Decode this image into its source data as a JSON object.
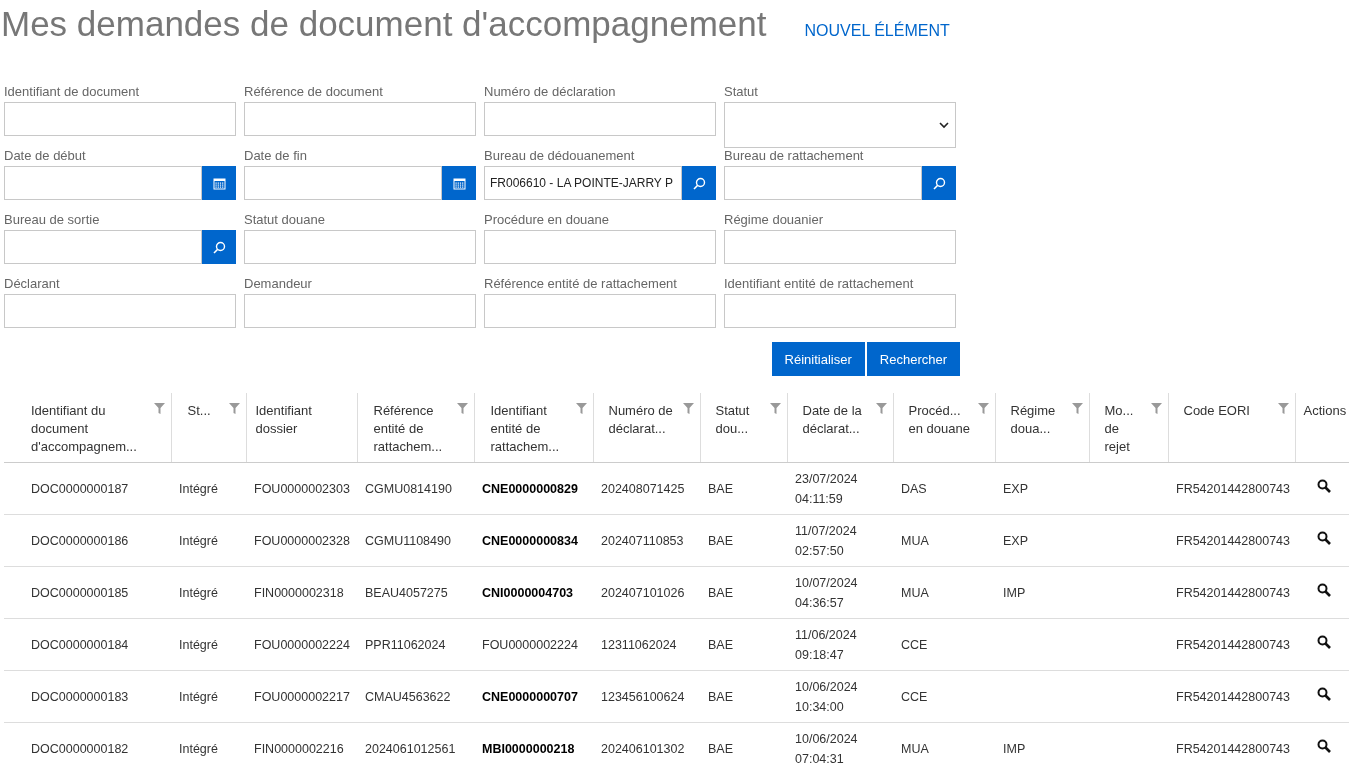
{
  "header": {
    "title": "Mes demandes de document d'accompagnement",
    "new_link": "NOUVEL ÉLÉMENT"
  },
  "filters": [
    {
      "label": "Identifiant de document",
      "kind": "text"
    },
    {
      "label": "Référence de document",
      "kind": "text"
    },
    {
      "label": "Numéro de déclaration",
      "kind": "text"
    },
    {
      "label": "Statut",
      "kind": "select"
    },
    {
      "label": "Date de début",
      "kind": "date"
    },
    {
      "label": "Date de fin",
      "kind": "date"
    },
    {
      "label": "Bureau de dédouanement",
      "kind": "lookup",
      "value": "FR006610 - LA POINTE-JARRY P"
    },
    {
      "label": "Bureau de rattachement",
      "kind": "lookup"
    },
    {
      "label": "Bureau de sortie",
      "kind": "lookup"
    },
    {
      "label": "Statut douane",
      "kind": "text"
    },
    {
      "label": "Procédure en douane",
      "kind": "text"
    },
    {
      "label": "Régime douanier",
      "kind": "text"
    },
    {
      "label": "Déclarant",
      "kind": "text"
    },
    {
      "label": "Demandeur",
      "kind": "text"
    },
    {
      "label": "Référence entité de rattachement",
      "kind": "text"
    },
    {
      "label": "Identifiant entité de rattachement",
      "kind": "text"
    }
  ],
  "buttons": [
    "Réinitialiser",
    "Rechercher"
  ],
  "table": {
    "columns": [
      {
        "label": "Identifiant du document d'accompagnem...",
        "filterable": true
      },
      {
        "label": "St...",
        "filterable": true
      },
      {
        "label": "Identifiant dossier",
        "filterable": false
      },
      {
        "label": "Référence entité de rattachem...",
        "filterable": true
      },
      {
        "label": "Identifiant entité de rattachem...",
        "filterable": true
      },
      {
        "label": "Numéro de déclarat...",
        "filterable": true
      },
      {
        "label": "Statut dou...",
        "filterable": true
      },
      {
        "label": "Date de la déclarat...",
        "filterable": true
      },
      {
        "label": "Procéd... en douane",
        "filterable": true
      },
      {
        "label": "Régime doua...",
        "filterable": true
      },
      {
        "label": "Mo... de rejet",
        "filterable": true
      },
      {
        "label": "Code EORI",
        "filterable": true
      },
      {
        "label": "Actions",
        "filterable": false
      }
    ],
    "rows": [
      {
        "entity_bold": true,
        "cells": [
          "DOC0000000187",
          "Intégré",
          "FOU0000002303",
          "CGMU0814190",
          "CNE0000000829",
          "202408071425",
          "BAE",
          "23/07/2024 04:11:59",
          "DAS",
          "EXP",
          "",
          "FR54201442800743"
        ]
      },
      {
        "entity_bold": true,
        "cells": [
          "DOC0000000186",
          "Intégré",
          "FOU0000002328",
          "CGMU1108490",
          "CNE0000000834",
          "202407110853",
          "BAE",
          "11/07/2024 02:57:50",
          "MUA",
          "EXP",
          "",
          "FR54201442800743"
        ]
      },
      {
        "entity_bold": true,
        "cells": [
          "DOC0000000185",
          "Intégré",
          "FIN0000002318",
          "BEAU4057275",
          "CNI0000004703",
          "202407101026",
          "BAE",
          "10/07/2024 04:36:57",
          "MUA",
          "IMP",
          "",
          "FR54201442800743"
        ]
      },
      {
        "entity_bold": false,
        "cells": [
          "DOC0000000184",
          "Intégré",
          "FOU0000002224",
          "PPR11062024",
          "FOU0000002224",
          "12311062024",
          "BAE",
          "11/06/2024 09:18:47",
          "CCE",
          "",
          "",
          "FR54201442800743"
        ]
      },
      {
        "entity_bold": true,
        "cells": [
          "DOC0000000183",
          "Intégré",
          "FOU0000002217",
          "CMAU4563622",
          "CNE0000000707",
          "123456100624",
          "BAE",
          "10/06/2024 10:34:00",
          "CCE",
          "",
          "",
          "FR54201442800743"
        ]
      },
      {
        "entity_bold": true,
        "cells": [
          "DOC0000000182",
          "Intégré",
          "FIN0000002216",
          "2024061012561",
          "MBI0000000218",
          "202406101302",
          "BAE",
          "10/06/2024 07:04:31",
          "MUA",
          "IMP",
          "",
          "FR54201442800743"
        ]
      }
    ]
  }
}
